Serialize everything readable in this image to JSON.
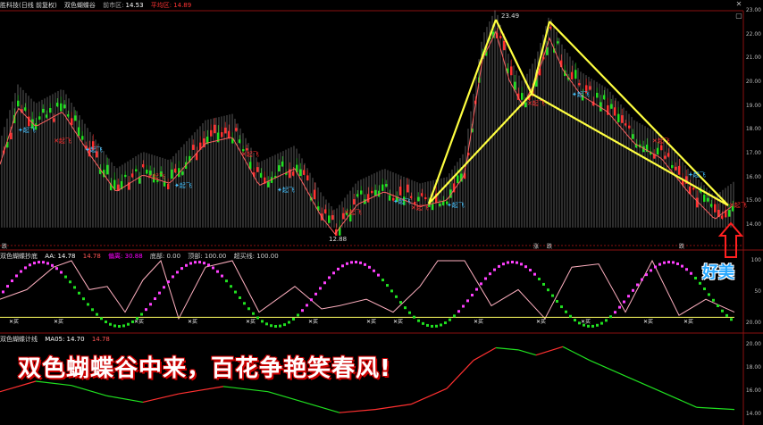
{
  "header": {
    "stock": "胜科技(日线 前复权)",
    "indicator": "双色蝴蝶谷",
    "close_label": "前市区:",
    "close_value": "14.53",
    "avg_label": "平均区:",
    "avg_value": "14.89",
    "peak_label": "23.49",
    "low_label": "12.88"
  },
  "panel2": {
    "name": "双色蝴蝶抄底",
    "aa_label": "AA: 14.78",
    "v2": "14.78",
    "dev_label": "偏离: 30.88",
    "bot_label": "底部: 0.00",
    "top_label": "顶部: 100.00",
    "over_label": "超买线: 100.00"
  },
  "panel3": {
    "name": "双色蝴蝶计线",
    "ma_label": "MA05: 14.70",
    "v2": "14.78"
  },
  "main_axis": [
    "23.00",
    "22.00",
    "21.00",
    "20.00",
    "19.00",
    "18.00",
    "17.00",
    "16.00",
    "15.00",
    "14.00"
  ],
  "p2_axis": [
    "100",
    "50",
    "20.00"
  ],
  "p3_axis": [
    "20.00",
    "18.00",
    "16.00",
    "14.00"
  ],
  "signals": {
    "fly": "起飞",
    "sell": "卖",
    "buy": "买"
  },
  "bottom_labels": [
    "跌",
    "涨",
    "跌",
    "跌"
  ],
  "caption": "双色蝴蝶谷中来，百花争艳笑春风!",
  "badge": "好美",
  "colors": {
    "up": "#ff3030",
    "down": "#20e020",
    "yellow": "#ffff40",
    "magenta": "#ff40ff",
    "pink": "#ffb0c0",
    "bg": "#000000"
  }
}
